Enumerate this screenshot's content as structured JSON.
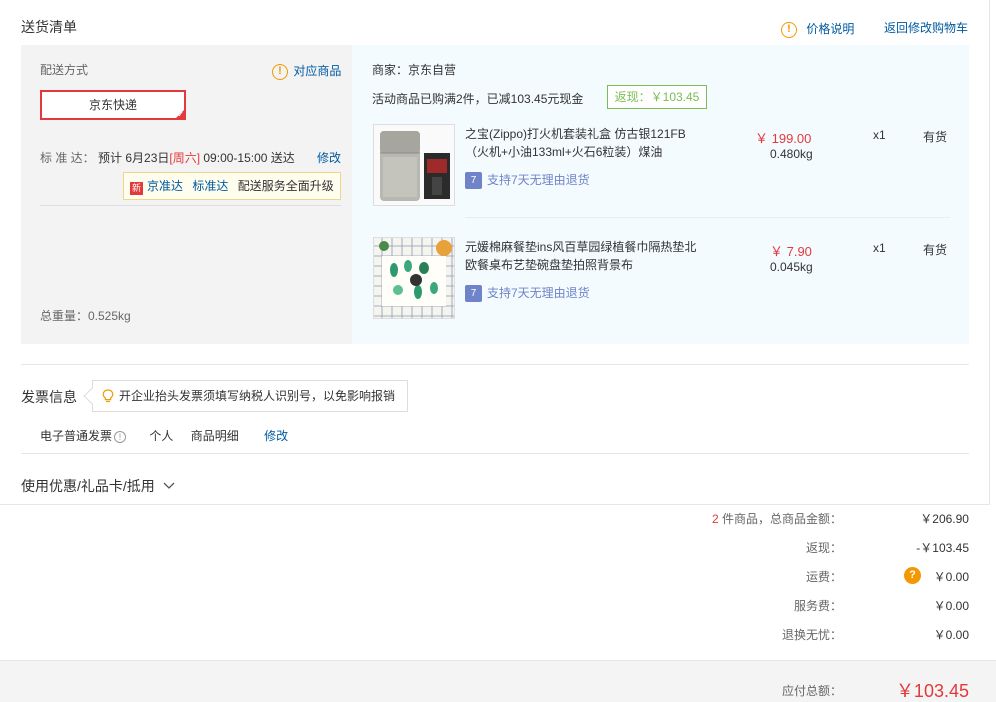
{
  "header": {
    "title": "送货清单",
    "price_note": "价格说明",
    "back_to_cart": "返回修改购物车"
  },
  "shipping": {
    "method_label": "配送方式",
    "related_goods": "对应商品",
    "method_selected": "京东快递",
    "standard_label": "标 准 达：",
    "eta_prefix": "预计 6月23日",
    "eta_weekday": "[周六]",
    "eta_time": " 09:00-15:00 送达",
    "modify": "修改",
    "promo_new": "新",
    "promo_link1": "京准达",
    "promo_link2": "标准达",
    "promo_text": "配送服务全面升级",
    "total_weight": "总重量：0.525kg"
  },
  "seller": {
    "name": "商家：京东自营",
    "activity": "活动商品已购满2件，已减103.45元现金",
    "rebate": "返现：￥103.45"
  },
  "items": [
    {
      "name": "之宝(Zippo)打火机套装礼盒 仿古银121FB（火机+小油133ml+火石6粒装）煤油",
      "price": "￥ 199.00",
      "weight": "0.480kg",
      "qty": "x1",
      "stock": "有货",
      "service": "支持7天无理由退货"
    },
    {
      "name": "元媛棉麻餐垫ins风百草园绿植餐巾隔热垫北欧餐桌布艺垫碗盘垫拍照背景布",
      "price": "￥ 7.90",
      "weight": "0.045kg",
      "qty": "x1",
      "stock": "有货",
      "service": "支持7天无理由退货"
    }
  ],
  "invoice": {
    "title": "发票信息",
    "tip": "开企业抬头发票须填写纳税人识别号，以免影响报销",
    "type": "电子普通发票",
    "type_info": "!",
    "holder": "个人",
    "content": "商品明细",
    "modify": "修改"
  },
  "coupon": {
    "label": "使用优惠/礼品卡/抵用"
  },
  "summary": {
    "count": "2",
    "count_label": " 件商品，总商品金额：",
    "goods_total": "￥206.90",
    "rebate_label": "返现：",
    "rebate_value": "-￥103.45",
    "freight_label": "运费：",
    "freight_q": "?",
    "freight_value": "￥0.00",
    "service_label": "服务费：",
    "service_value": "￥0.00",
    "return_label": "退换无忧：",
    "return_value": "￥0.00",
    "payable_label": "应付总额：",
    "payable_value": "￥103.45"
  },
  "colors": {
    "accent_red": "#e4393c",
    "link_blue": "#005aa0",
    "warn_orange": "#f39800",
    "rebate_green": "#7abd54"
  },
  "icons": [
    "warning-circle-icon",
    "checkmark-corner-icon",
    "service-7day-icon",
    "lightbulb-icon",
    "info-circle-icon",
    "chevron-down-icon",
    "question-icon"
  ]
}
